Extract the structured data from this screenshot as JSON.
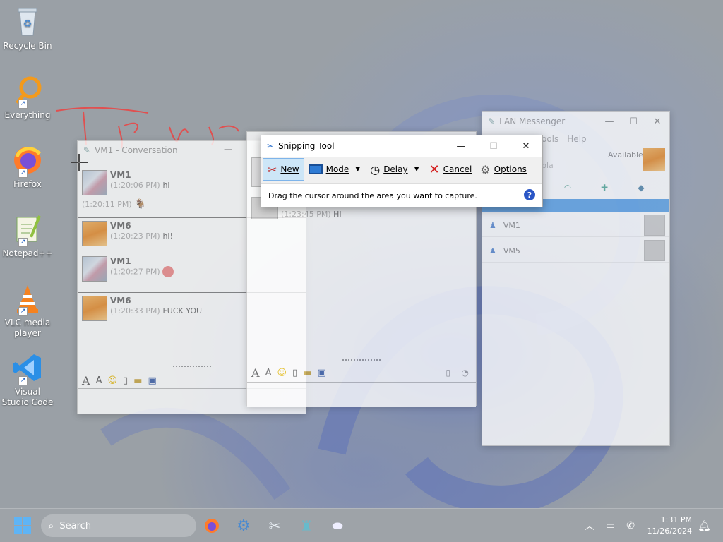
{
  "desktop": {
    "icons": [
      {
        "label": "Recycle Bin",
        "icon": "recycle-bin-icon"
      },
      {
        "label": "Everything",
        "icon": "everything-search-icon"
      },
      {
        "label": "Firefox",
        "icon": "firefox-icon"
      },
      {
        "label": "Notepad++",
        "icon": "notepad-plus-plus-icon"
      },
      {
        "label": "VLC media player",
        "icon": "vlc-icon"
      },
      {
        "label": "Visual Studio Code",
        "icon": "vscode-icon"
      }
    ]
  },
  "conversation_vm1": {
    "title": "VM1 - Conversation",
    "messages": [
      {
        "sender": "VM1",
        "time": "(1:20:06 PM)",
        "text": "hi"
      },
      {
        "sender": "",
        "time": "(1:20:11 PM)",
        "text": ""
      },
      {
        "sender": "VM6",
        "time": "(1:20:23 PM)",
        "text": "hi!"
      },
      {
        "sender": "VM1",
        "time": "(1:20:27 PM)",
        "text": ""
      },
      {
        "sender": "VM6",
        "time": "(1:20:33 PM)",
        "text": "FUCK YOU"
      }
    ]
  },
  "conversation_vm5": {
    "messages": [
      {
        "time": "(1:23:45 PM)",
        "text": "HI"
      }
    ]
  },
  "lan_messenger": {
    "title": "LAN Messenger",
    "menu": [
      "ools",
      "Help"
    ],
    "status": "Available",
    "contacts": [
      "VM1",
      "VM5"
    ]
  },
  "snipping_tool": {
    "title": "Snipping Tool",
    "buttons": {
      "new": "New",
      "mode": "Mode",
      "delay": "Delay",
      "cancel": "Cancel",
      "options": "Options"
    },
    "message": "Drag the cursor around the area you want to capture."
  },
  "taskbar": {
    "search_placeholder": "Search",
    "time": "1:31 PM",
    "date": "11/26/2024"
  },
  "colors": {
    "accent": "#0078d4",
    "selection": "#cde6f7",
    "cancel_red": "#d42020"
  }
}
